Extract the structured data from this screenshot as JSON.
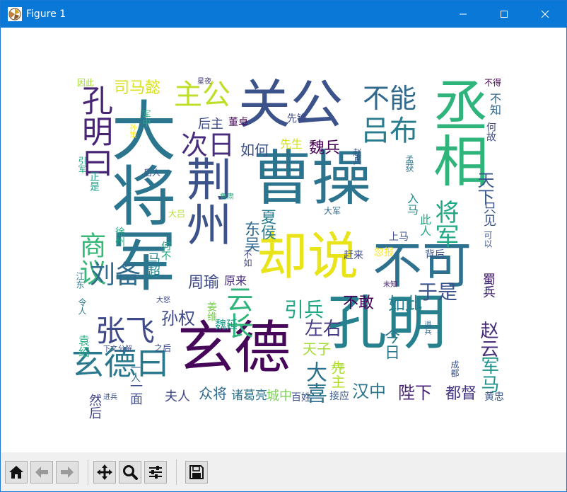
{
  "window": {
    "title": "Figure 1"
  },
  "wordcloud": {
    "words": [
      {
        "text": "曹操",
        "color": "#2c738e"
      },
      {
        "text": "大将军",
        "color": "#2b758e"
      },
      {
        "text": "孔明",
        "color": "#27808e"
      },
      {
        "text": "玄德",
        "color": "#46075a"
      },
      {
        "text": "丞相",
        "color": "#2fb47c"
      },
      {
        "text": "关公",
        "color": "#3b528b"
      },
      {
        "text": "却说",
        "color": "#e8e419"
      },
      {
        "text": "不可",
        "color": "#2d718e"
      },
      {
        "text": "荆州",
        "color": "#3b528b"
      },
      {
        "text": "玄德曰",
        "color": "#2a788e"
      },
      {
        "text": "孔明曰",
        "color": "#482475"
      },
      {
        "text": "张飞",
        "color": "#3e4a89"
      },
      {
        "text": "主公",
        "color": "#bddf26"
      },
      {
        "text": "吕布",
        "color": "#297b8e"
      },
      {
        "text": "不能",
        "color": "#31688e"
      },
      {
        "text": "次日",
        "color": "#472d7b"
      },
      {
        "text": "商议",
        "color": "#37b878"
      },
      {
        "text": "云长",
        "color": "#2fb47c"
      },
      {
        "text": "刘备",
        "color": "#2f6c8e"
      },
      {
        "text": "将军",
        "color": "#22a785"
      },
      {
        "text": "天下",
        "color": "#38588c"
      },
      {
        "text": "孙权",
        "color": "#3e4a89"
      },
      {
        "text": "左右",
        "color": "#443a83"
      },
      {
        "text": "引兵",
        "color": "#22a785"
      },
      {
        "text": "于是",
        "color": "#3b528b"
      },
      {
        "text": "赵云",
        "color": "#472d7b"
      },
      {
        "text": "军马",
        "color": "#20928c"
      },
      {
        "text": "大喜",
        "color": "#2d708e"
      },
      {
        "text": "汉中",
        "color": "#2b758e"
      },
      {
        "text": "陛下",
        "color": "#482475"
      },
      {
        "text": "都督",
        "color": "#453581"
      },
      {
        "text": "司马懿",
        "color": "#d8e219"
      },
      {
        "text": "魏兵",
        "color": "#440154"
      },
      {
        "text": "如何",
        "color": "#3b528b"
      },
      {
        "text": "东吴",
        "color": "#31688e"
      },
      {
        "text": "夏侯",
        "color": "#287c8e"
      },
      {
        "text": "周瑜",
        "color": "#3e4a89"
      },
      {
        "text": "如此",
        "color": "#26828e"
      },
      {
        "text": "不敢",
        "color": "#440154"
      },
      {
        "text": "今日",
        "color": "#2a788e"
      },
      {
        "text": "天子",
        "color": "#a5db36"
      },
      {
        "text": "先主",
        "color": "#b5de2b"
      },
      {
        "text": "众将",
        "color": "#31688e"
      },
      {
        "text": "夫人",
        "color": "#404688"
      },
      {
        "text": "一面",
        "color": "#3e4a89"
      },
      {
        "text": "然后",
        "color": "#414487"
      },
      {
        "text": "诸葛亮",
        "color": "#2c738e"
      },
      {
        "text": "城中",
        "color": "#7ad151"
      },
      {
        "text": "百姓",
        "color": "#3b528b"
      },
      {
        "text": "接应",
        "color": "#38588c"
      },
      {
        "text": "黄忠",
        "color": "#38588c"
      },
      {
        "text": "蜀兵",
        "color": "#481f70"
      },
      {
        "text": "马超",
        "color": "#25858e"
      },
      {
        "text": "原来",
        "color": "#472d7b"
      },
      {
        "text": "魏延",
        "color": "#1f9e89"
      },
      {
        "text": "后主",
        "color": "#3e4a89"
      },
      {
        "text": "董卓",
        "color": "#46075a"
      },
      {
        "text": "先锋",
        "color": "#3e4a89"
      },
      {
        "text": "先生",
        "color": "#d2e21b"
      },
      {
        "text": "只见",
        "color": "#3b528b"
      },
      {
        "text": "入马",
        "color": "#228c8d"
      },
      {
        "text": "此人",
        "color": "#22a785"
      },
      {
        "text": "上马",
        "color": "#3b528b"
      },
      {
        "text": "袁绍",
        "color": "#25ab82"
      },
      {
        "text": "一人",
        "color": "#31688e"
      },
      {
        "text": "赶来",
        "color": "#3e4a89"
      },
      {
        "text": "忽报",
        "color": "#fde725"
      },
      {
        "text": "背后",
        "color": "#3b528b"
      },
      {
        "text": "因此",
        "color": "#a5db36"
      },
      {
        "text": "星夜",
        "color": "#44397c"
      },
      {
        "text": "不得",
        "color": "#440154"
      },
      {
        "text": "不知",
        "color": "#31688e"
      },
      {
        "text": "何故",
        "color": "#3e4a89"
      },
      {
        "text": "孟获",
        "color": "#2a788e"
      },
      {
        "text": "成都",
        "color": "#3b528b"
      },
      {
        "text": "大事",
        "color": "#a5db36"
      },
      {
        "text": "大军",
        "color": "#31688e"
      },
      {
        "text": "大怒",
        "color": "#3e4a89"
      },
      {
        "text": "江东",
        "color": "#2a788e"
      },
      {
        "text": "不如",
        "color": "#414487"
      },
      {
        "text": "何不",
        "color": "#22a785"
      },
      {
        "text": "徐州",
        "color": "#25ab82"
      },
      {
        "text": "未知",
        "color": "#482475"
      },
      {
        "text": "之后",
        "color": "#3e4a89"
      },
      {
        "text": "分解",
        "color": "#3e4a89"
      },
      {
        "text": "下文",
        "color": "#3e4a89"
      },
      {
        "text": "进兵",
        "color": "#3b528b"
      },
      {
        "text": "令人",
        "color": "#2a788e"
      },
      {
        "text": "姜维",
        "color": "#7ad151"
      },
      {
        "text": "军中",
        "color": "#25ab82"
      },
      {
        "text": "孙策",
        "color": "#fde725"
      },
      {
        "text": "引军",
        "color": "#22a785"
      },
      {
        "text": "正是",
        "color": "#1f9e89"
      },
      {
        "text": "后人",
        "color": "#3b528b"
      },
      {
        "text": "鲁肃",
        "color": "#25ab82"
      },
      {
        "text": "赵兵",
        "color": "#3b528b"
      },
      {
        "text": "可以",
        "color": "#3b528b"
      },
      {
        "text": "一齐",
        "color": "#3b528b"
      },
      {
        "text": "退兵",
        "color": "#31688e"
      },
      {
        "text": "大吕",
        "color": "#b5de2b"
      }
    ]
  },
  "toolbar": {
    "buttons": [
      {
        "name": "home-icon"
      },
      {
        "name": "back-arrow-icon"
      },
      {
        "name": "forward-arrow-icon"
      },
      {
        "name": "pan-icon"
      },
      {
        "name": "zoom-icon"
      },
      {
        "name": "configure-subplots-icon"
      },
      {
        "name": "save-icon"
      }
    ]
  }
}
